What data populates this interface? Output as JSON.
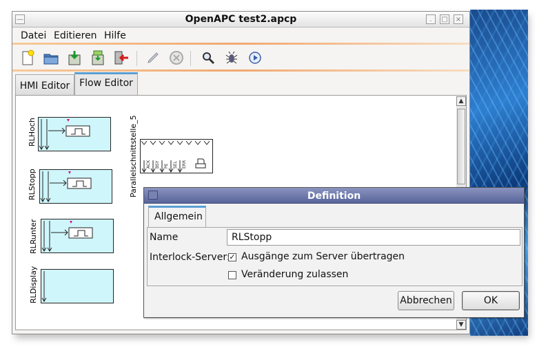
{
  "window": {
    "title": "OpenAPC test2.apcp"
  },
  "menu": {
    "items": [
      "Datei",
      "Editieren",
      "Hilfe"
    ]
  },
  "toolbar": {
    "icons": [
      "new-file-icon",
      "open-folder-icon",
      "save-icon",
      "save-as-icon",
      "exit-icon",
      "edit-pencil-icon",
      "delete-circle-icon",
      "search-icon",
      "debug-bug-icon",
      "play-icon"
    ]
  },
  "tabs": [
    {
      "label": "HMI Editor",
      "active": false
    },
    {
      "label": "Flow Editor",
      "active": true
    }
  ],
  "flow": {
    "blocks": [
      {
        "label": "RLHoch"
      },
      {
        "label": "RLStopp"
      },
      {
        "label": "RLRunter"
      },
      {
        "label": "RLDisplay"
      }
    ],
    "parallel": {
      "label": "Parallelschnittstelle_5",
      "pins": [
        "ACK",
        "BSY",
        "PE",
        "SEL",
        "ERR"
      ]
    }
  },
  "dialog": {
    "title": "Definition",
    "tab": "Allgemein",
    "name_label": "Name",
    "name_value": "RLStopp",
    "interlock_label": "Interlock-Server:",
    "opt_transfer": {
      "label": "Ausgänge zum Server übertragen",
      "checked": true
    },
    "opt_change": {
      "label": "Veränderung zulassen",
      "checked": false
    },
    "cancel": "Abbrechen",
    "ok": "OK"
  },
  "colors": {
    "block_fill": "#cff6fb",
    "dialog_title": "#58649a",
    "tab_accent": "#5a9fd4",
    "marker": "#c2188a"
  }
}
